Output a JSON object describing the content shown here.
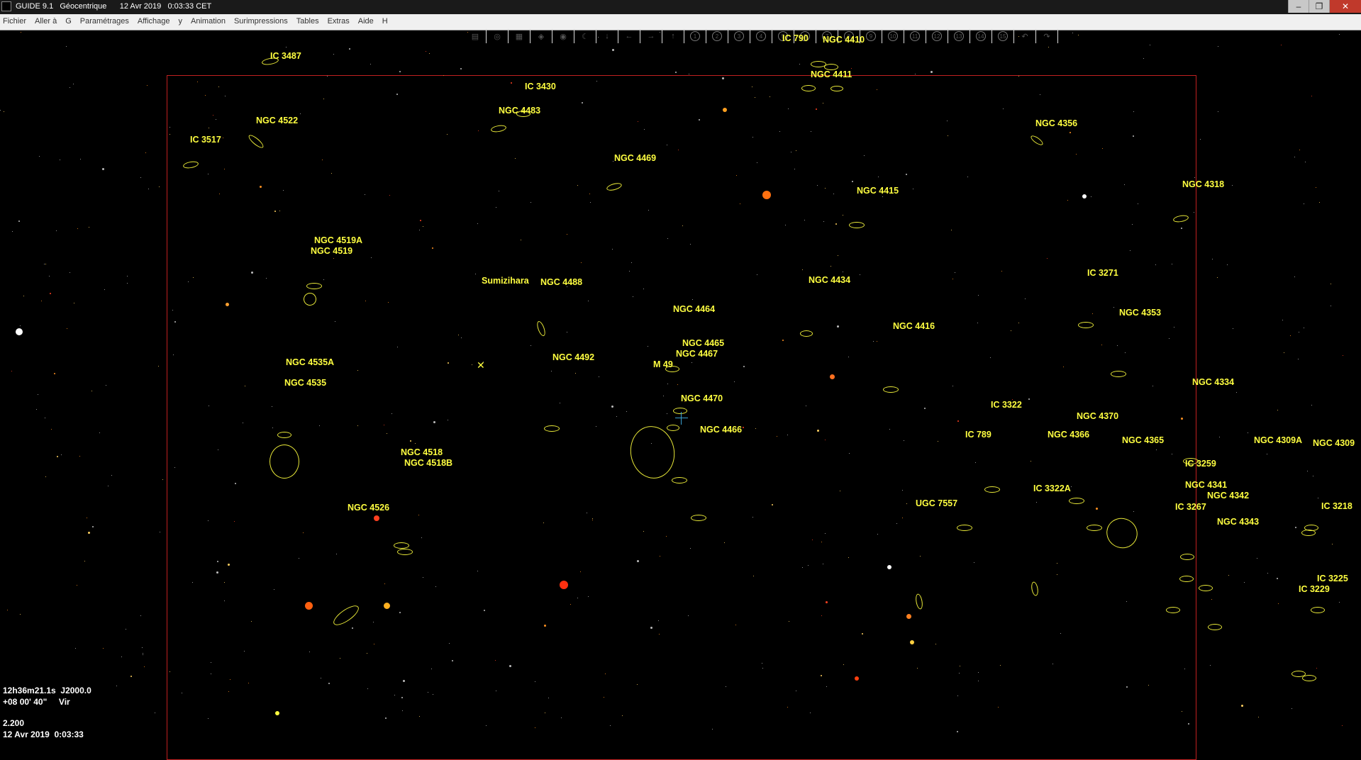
{
  "title": {
    "app": "GUIDE 9.1",
    "mode": "Géocentrique",
    "date": "12 Avr 2019",
    "time": "0:03:33 CET"
  },
  "menu": [
    "Fichier",
    "Aller à",
    "G",
    "Paramétrages",
    "Affichage",
    "y",
    "Animation",
    "Surimpressions",
    "Tables",
    "Extras",
    "Aide",
    "H"
  ],
  "toolbar_icons": [
    "print-icon",
    "lens-icon",
    "grid-icon",
    "layers-icon",
    "target-icon",
    "moon-icon",
    "down-arrow-icon",
    "left-arrow-icon",
    "right-arrow-icon",
    "up-arrow-icon",
    "zoom-1-icon",
    "zoom-2-icon",
    "zoom-3-icon",
    "zoom-4-icon",
    "zoom-5-icon",
    "zoom-6-icon",
    "zoom-7-icon",
    "zoom-8-icon",
    "zoom-9-icon",
    "zoom-10-icon",
    "zoom-11-icon",
    "zoom-12-icon",
    "zoom-13-icon",
    "zoom-14-icon",
    "zoom-15-icon",
    "undo-icon",
    "redo-icon"
  ],
  "labels": [
    {
      "t": "IC 3487"
    },
    {
      "t": "IC 790"
    },
    {
      "t": "NGC 4410"
    },
    {
      "t": "IC 3430"
    },
    {
      "t": "NGC 4411"
    },
    {
      "t": "NGC 4483"
    },
    {
      "t": "NGC 4522"
    },
    {
      "t": "NGC 4356"
    },
    {
      "t": "IC 3517"
    },
    {
      "t": "NGC 4469"
    },
    {
      "t": "NGC 4318"
    },
    {
      "t": "NGC 4415"
    },
    {
      "t": "NGC 4519A"
    },
    {
      "t": "NGC 4519"
    },
    {
      "t": "Sumizihara"
    },
    {
      "t": "NGC 4488"
    },
    {
      "t": "NGC 4434"
    },
    {
      "t": "IC 3271"
    },
    {
      "t": "NGC 4464"
    },
    {
      "t": "NGC 4353"
    },
    {
      "t": "NGC 4416"
    },
    {
      "t": "NGC 4465"
    },
    {
      "t": "NGC 4467"
    },
    {
      "t": "NGC 4535A"
    },
    {
      "t": "NGC 4492"
    },
    {
      "t": "M 49"
    },
    {
      "t": "NGC 4535"
    },
    {
      "t": "NGC 4334"
    },
    {
      "t": "NGC 4470"
    },
    {
      "t": "IC 3322"
    },
    {
      "t": "NGC 4370"
    },
    {
      "t": "NGC 4466"
    },
    {
      "t": "IC 789"
    },
    {
      "t": "NGC 4366"
    },
    {
      "t": "NGC 4365"
    },
    {
      "t": "NGC 4309A"
    },
    {
      "t": "NGC 4309"
    },
    {
      "t": "NGC 4518"
    },
    {
      "t": "NGC 4518B"
    },
    {
      "t": "IC 3259"
    },
    {
      "t": "NGC 4341"
    },
    {
      "t": "IC 3322A"
    },
    {
      "t": "NGC 4342"
    },
    {
      "t": "UGC 7557"
    },
    {
      "t": "NGC 4526"
    },
    {
      "t": "IC 3267"
    },
    {
      "t": "IC 3218"
    },
    {
      "t": "NGC 4343"
    },
    {
      "t": "IC 3225"
    },
    {
      "t": "IC 3229"
    }
  ],
  "info": {
    "ra": "12h36m21.1s  J2000.0",
    "dec": "+08 00' 40\"     Vir",
    "fov": "2.200",
    "datetime": "12 Avr 2019  0:03:33"
  }
}
